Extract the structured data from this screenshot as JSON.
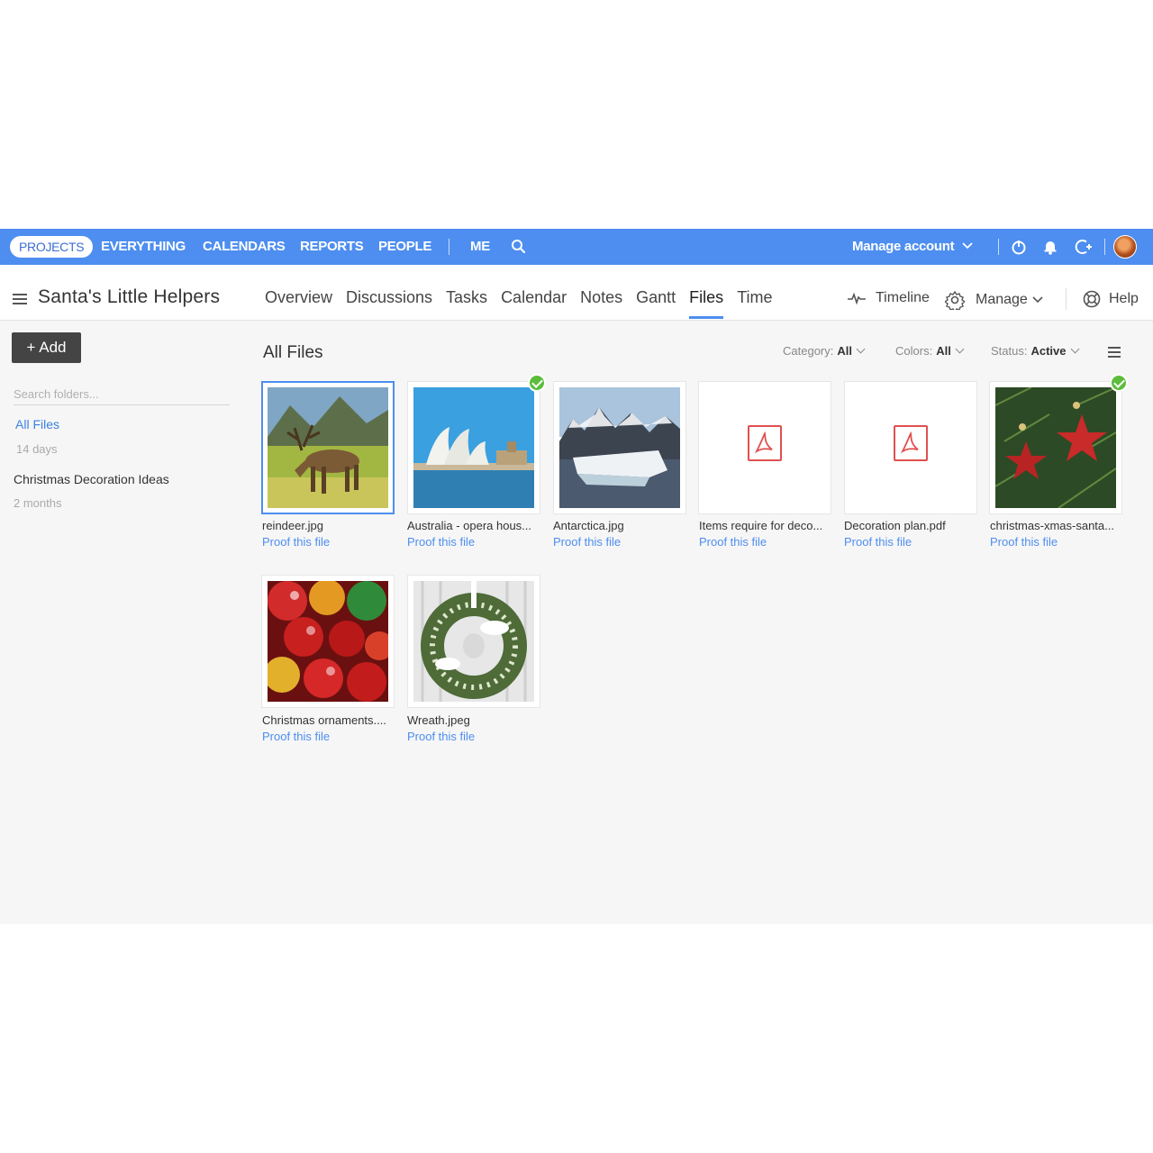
{
  "topnav": {
    "items": [
      "PROJECTS",
      "EVERYTHING",
      "CALENDARS",
      "REPORTS",
      "PEOPLE",
      "ME"
    ],
    "manage_account": "Manage account"
  },
  "project": {
    "title": "Santa's Little Helpers",
    "tabs": [
      "Overview",
      "Discussions",
      "Tasks",
      "Calendar",
      "Notes",
      "Gantt",
      "Files",
      "Time"
    ],
    "active_tab": "Files",
    "timeline": "Timeline",
    "manage": "Manage",
    "help": "Help"
  },
  "sidebar": {
    "add_label": "+ Add",
    "search_placeholder": "Search folders...",
    "folders": [
      {
        "name": "All Files",
        "meta": "14 days"
      },
      {
        "name": "Christmas Decoration Ideas",
        "meta": "2 months"
      }
    ]
  },
  "main": {
    "title": "All Files",
    "filters": [
      {
        "label": "Category:",
        "value": "All"
      },
      {
        "label": "Colors:",
        "value": "All"
      },
      {
        "label": "Status:",
        "value": "Active"
      }
    ],
    "files": [
      {
        "name": "reindeer.jpg",
        "action": "Proof this file"
      },
      {
        "name": "Australia - opera hous...",
        "action": "Proof this file"
      },
      {
        "name": "Antarctica.jpg",
        "action": "Proof this file"
      },
      {
        "name": "Items require for deco...",
        "action": "Proof this file"
      },
      {
        "name": "Decoration plan.pdf",
        "action": "Proof this file"
      },
      {
        "name": "christmas-xmas-santa...",
        "action": "Proof this file"
      },
      {
        "name": "Christmas ornaments....",
        "action": "Proof this file"
      },
      {
        "name": "Wreath.jpeg",
        "action": "Proof this file"
      }
    ]
  },
  "colors": {
    "nav_blue": "#4d8ef0",
    "link_blue": "#4d8ef0",
    "approved_green": "#5bbd3a",
    "pdf_red": "#e05050"
  }
}
